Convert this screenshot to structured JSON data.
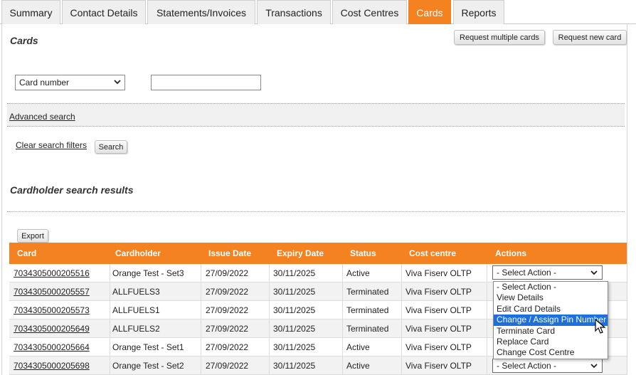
{
  "tabs": [
    {
      "label": "Summary"
    },
    {
      "label": "Contact Details"
    },
    {
      "label": "Statements/Invoices"
    },
    {
      "label": "Transactions"
    },
    {
      "label": "Cost Centres"
    },
    {
      "label": "Cards",
      "active": true
    },
    {
      "label": "Reports"
    }
  ],
  "section": {
    "title": "Cards",
    "request_multiple_label": "Request multiple cards",
    "request_new_label": "Request new card"
  },
  "search": {
    "field_select_value": "Card number",
    "search_value": "",
    "advanced_search_label": "Advanced search",
    "clear_filters_label": "Clear search filters",
    "search_button_label": "Search"
  },
  "results": {
    "title": "Cardholder search results",
    "export_label": "Export",
    "columns": [
      "Card",
      "Cardholder",
      "Issue Date",
      "Expiry Date",
      "Status",
      "Cost centre",
      "Actions"
    ],
    "rows": [
      {
        "card": "7034305000205516",
        "cardholder": "Orange Test - Set3",
        "issue": "27/09/2022",
        "expiry": "30/11/2025",
        "status": "Active",
        "cost_centre": "Viva Fiserv OLTP",
        "action": "- Select Action -"
      },
      {
        "card": "7034305000205557",
        "cardholder": "ALLFUELS3",
        "issue": "27/09/2022",
        "expiry": "30/11/2025",
        "status": "Terminated",
        "cost_centre": "Viva Fiserv OLTP",
        "action": ""
      },
      {
        "card": "7034305000205573",
        "cardholder": "ALLFUELS1",
        "issue": "27/09/2022",
        "expiry": "30/11/2025",
        "status": "Terminated",
        "cost_centre": "Viva Fiserv OLTP",
        "action": ""
      },
      {
        "card": "7034305000205649",
        "cardholder": "ALLFUELS2",
        "issue": "27/09/2022",
        "expiry": "30/11/2025",
        "status": "Terminated",
        "cost_centre": "Viva Fiserv OLTP",
        "action": ""
      },
      {
        "card": "7034305000205664",
        "cardholder": "Orange Test - Set1",
        "issue": "27/09/2022",
        "expiry": "30/11/2025",
        "status": "Active",
        "cost_centre": "Viva Fiserv OLTP",
        "action": ""
      },
      {
        "card": "7034305000205698",
        "cardholder": "Orange Test - Set2",
        "issue": "27/09/2022",
        "expiry": "30/11/2025",
        "status": "Active",
        "cost_centre": "Viva Fiserv OLTP",
        "action": "- Select Action -"
      }
    ]
  },
  "action_dropdown": {
    "options": [
      "- Select Action -",
      "View Details",
      "Edit Card Details",
      "Change / Assign Pin Number",
      "Terminate Card",
      "Replace Card",
      "Change Cost Centre"
    ],
    "highlighted": "Change / Assign Pin Number"
  },
  "colors": {
    "accent": "#f58220",
    "highlight": "#1e6fd9"
  },
  "icons": [
    "chevron-down-icon",
    "mouse-pointer-icon"
  ]
}
